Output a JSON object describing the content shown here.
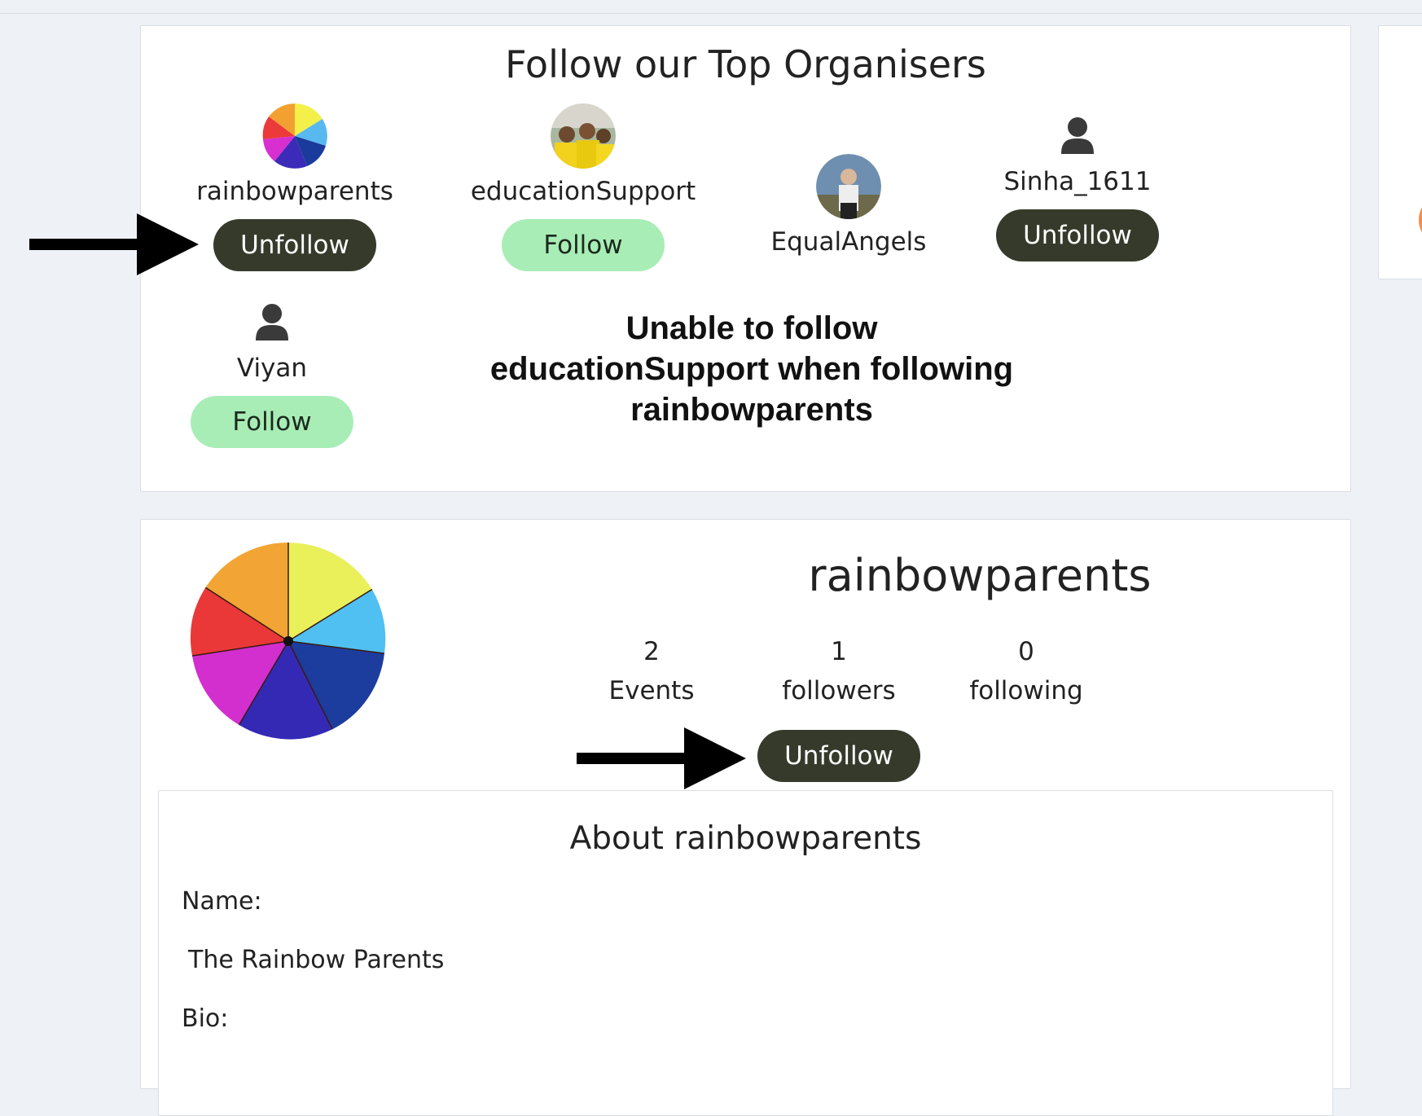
{
  "organisers": {
    "title": "Follow our Top Organisers",
    "items": [
      {
        "name": "rainbowparents",
        "button": "Unfollow",
        "avatar": "rainbow-umbrella-photo"
      },
      {
        "name": "educationSupport",
        "button": "Follow",
        "avatar": "group-photo"
      },
      {
        "name": "EqualAngels",
        "button": "",
        "avatar": "person-photo"
      },
      {
        "name": "Sinha_1611",
        "button": "Unfollow",
        "avatar": "person-icon"
      },
      {
        "name": "Viyan",
        "button": "Follow",
        "avatar": "person-icon"
      }
    ]
  },
  "annotation": {
    "line1": "Unable to follow",
    "line2": "educationSupport when following",
    "line3": "rainbowparents"
  },
  "profile": {
    "name": "rainbowparents",
    "stats": [
      {
        "value": "2",
        "label": "Events"
      },
      {
        "value": "1",
        "label": "followers"
      },
      {
        "value": "0",
        "label": "following"
      }
    ],
    "button": "Unfollow"
  },
  "about": {
    "title": "About rainbowparents",
    "name_label": "Name:",
    "name_value": "The Rainbow Parents",
    "bio_label": "Bio:"
  },
  "colors": {
    "unfollow_bg": "#363a2a",
    "follow_bg": "#a8edb6",
    "page_bg": "#eef2f7"
  }
}
